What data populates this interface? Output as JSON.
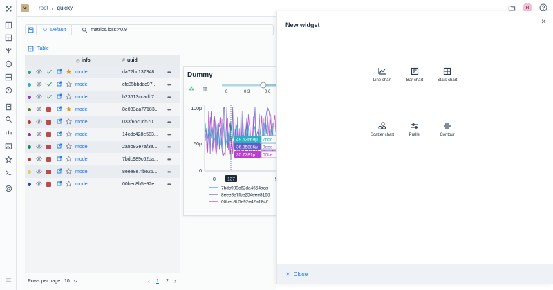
{
  "topbar": {
    "project_initial": "G",
    "root": "root",
    "separator": "/",
    "project": "quicky",
    "user_initial": "R"
  },
  "toolbar": {
    "view": "Default",
    "query": "metrics.loss:<0.9"
  },
  "table_tab": "Table",
  "columns": {
    "info": "info",
    "uuid": "uuid"
  },
  "rows": [
    {
      "name": "model",
      "uuid": "da72bc137348...",
      "color": "#2aa876",
      "status": "check",
      "starred": true
    },
    {
      "name": "model",
      "uuid": "cfc05bbdac97...",
      "color": "#2ab3c4",
      "status": "check",
      "starred": false
    },
    {
      "name": "model",
      "uuid": "b23613ccadb7...",
      "color": "#8e3bb0",
      "status": "check",
      "starred": false
    },
    {
      "name": "model",
      "uuid": "8e083aa77183...",
      "color": "#4c8b2b",
      "status": "stop",
      "starred": true
    },
    {
      "name": "model",
      "uuid": "033f66c0d570...",
      "color": "#c0392b",
      "status": "stop",
      "starred": false
    },
    {
      "name": "model",
      "uuid": "14cdc428e583...",
      "color": "#9b2fa8",
      "status": "stop",
      "starred": false
    },
    {
      "name": "model",
      "uuid": "2a8b93e7af3a...",
      "color": "#1b8a5a",
      "status": "stop",
      "starred": false
    },
    {
      "name": "model",
      "uuid": "7bdc989c62da...",
      "color": "#b0452b",
      "status": "stop",
      "starred": false
    },
    {
      "name": "model",
      "uuid": "8eee8e7fbe25...",
      "color": "#e3d15a",
      "status": "stop",
      "starred": false
    },
    {
      "name": "model",
      "uuid": "00bec8b5e92e...",
      "color": "#2446d8",
      "status": "stop",
      "starred": false
    }
  ],
  "footer": {
    "rows_per_page_label": "Rows per page:",
    "rows_per_page": "10",
    "page1": "1",
    "page2": "2"
  },
  "chart_card": {
    "title": "Dummy"
  },
  "chart_data": {
    "type": "line",
    "title": "Dummy",
    "yticks": [
      "100μ",
      "50μ",
      "0"
    ],
    "xticks": [
      "0",
      "5"
    ],
    "slider_ticks": [
      "0",
      "0.3",
      "0.6"
    ],
    "cursor_x": "137",
    "tooltip_values": [
      "49.62669μ",
      "36.35886μ",
      "35.7281μ"
    ],
    "tooltip_labels": [
      "7bdc",
      "8eee",
      "00be"
    ],
    "series": [
      {
        "name": "7bdc989c62da4654aca",
        "color": "#2ab3c4"
      },
      {
        "name": "8eee8e7fbe254eee8165",
        "color": "#6a5bc9"
      },
      {
        "name": "00bec8b5e92e42a1840",
        "color": "#c13fd0"
      }
    ]
  },
  "panel": {
    "title": "New widget",
    "widgets": [
      {
        "label": "Line chart",
        "icon": "line-chart-icon"
      },
      {
        "label": "Bar chart",
        "icon": "bar-chart-icon"
      },
      {
        "label": "Stats chart",
        "icon": "stats-chart-icon"
      },
      {
        "label": "Scatter chart",
        "icon": "scatter-chart-icon"
      },
      {
        "label": "Prallel",
        "icon": "parallel-icon"
      },
      {
        "label": "Contour",
        "icon": "contour-icon"
      }
    ],
    "close_label": "Close"
  },
  "colors": {
    "accent": "#1473e6"
  }
}
